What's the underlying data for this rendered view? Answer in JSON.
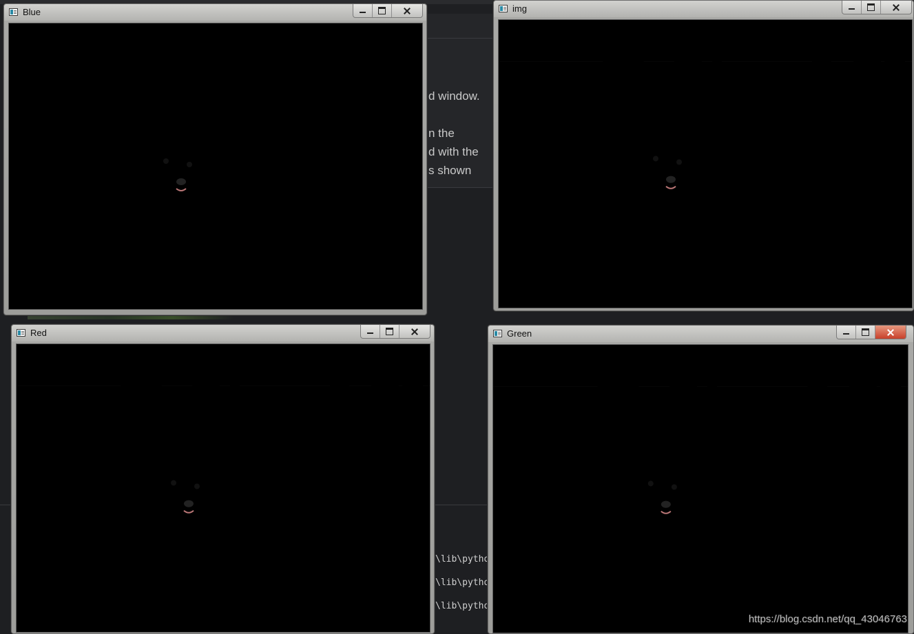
{
  "windows": {
    "blue": {
      "title": "Blue",
      "tint": "gray-dark"
    },
    "img": {
      "title": "img",
      "tint": "color"
    },
    "red": {
      "title": "Red",
      "tint": "gray-light"
    },
    "green": {
      "title": "Green",
      "tint": "gray-mid"
    }
  },
  "background_text": {
    "lines": [
      "d window.",
      "n the",
      "d with the",
      "s shown"
    ],
    "terminal": [
      "\\lib\\python",
      "\\lib\\python",
      "\\lib\\python"
    ]
  },
  "watermark": "https://blog.csdn.net/qq_43046763",
  "colors": {
    "floor_color": "#d89a4a",
    "puppy_color": "#f7ead0",
    "close_active": "#c8402a"
  }
}
